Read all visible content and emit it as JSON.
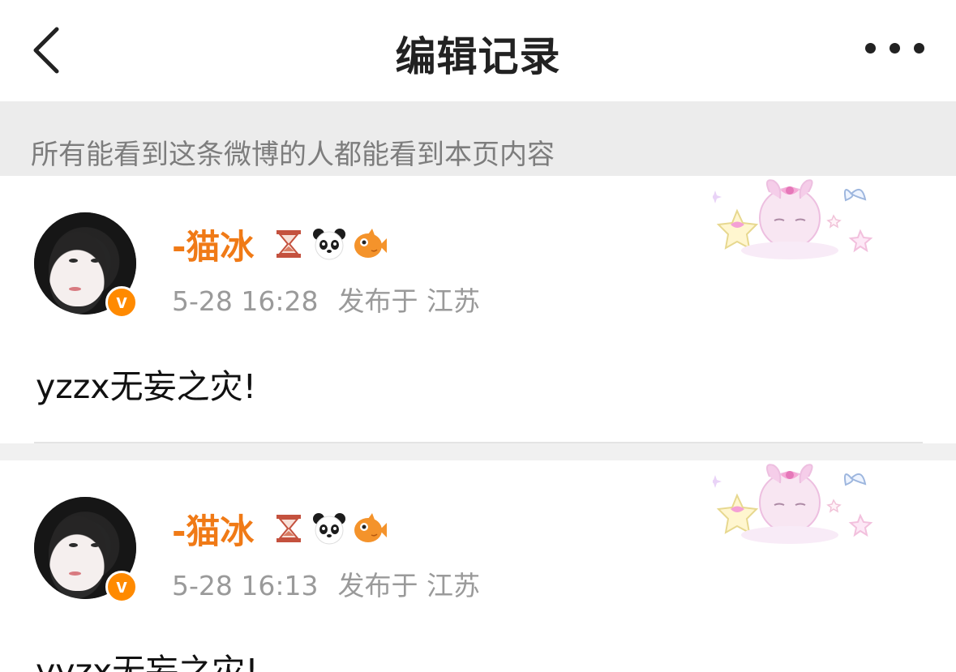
{
  "nav": {
    "title": "编辑记录",
    "back_icon": "chevron-left-icon",
    "more_icon": "more-dots-icon"
  },
  "notice": "所有能看到这条微博的人都能看到本页内容",
  "colors": {
    "username": "#f07a16",
    "meta": "#9a9a9a",
    "notice_bg": "#ececec",
    "badge": "#ff8a00"
  },
  "records": [
    {
      "username": "-猫冰",
      "time": "5-28 16:28",
      "location": "发布于 江苏",
      "content": "yzzx无妄之灾!",
      "badges": [
        "hourglass-icon",
        "panda-icon",
        "fish-icon"
      ],
      "verified": "v"
    },
    {
      "username": "-猫冰",
      "time": "5-28 16:13",
      "location": "发布于 江苏",
      "content": "yyzx无妄之灾!",
      "badges": [
        "hourglass-icon",
        "panda-icon",
        "fish-icon"
      ],
      "verified": "v"
    }
  ]
}
